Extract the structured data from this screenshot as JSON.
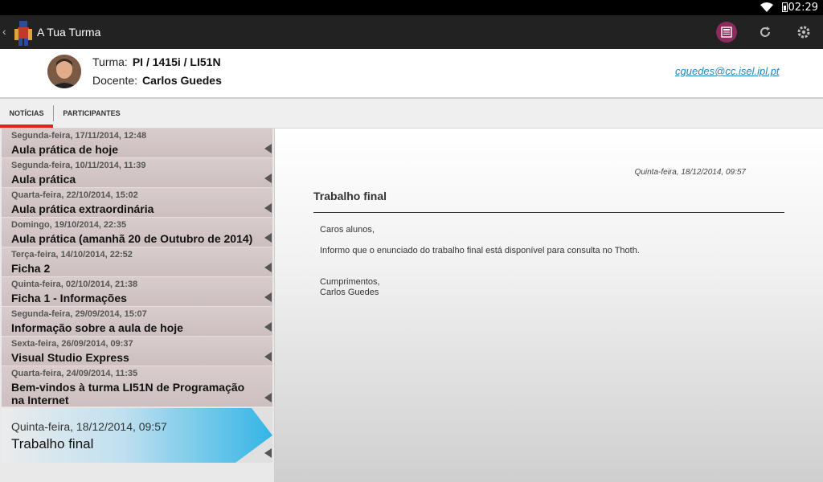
{
  "status_bar": {
    "time": "02:29",
    "wifi_icon": "wifi-icon",
    "battery_icon": "battery-icon"
  },
  "action_bar": {
    "back_icon": "chevron-left-icon",
    "app_title": "A Tua Turma",
    "actions": [
      {
        "name": "news-icon",
        "color": "#8e2b5e"
      },
      {
        "name": "refresh-icon"
      },
      {
        "name": "settings-icon"
      }
    ]
  },
  "header": {
    "turma_label": "Turma:",
    "turma_value": "PI / 1415i / LI51N",
    "docente_label": "Docente:",
    "docente_value": "Carlos Guedes",
    "email": "cguedes@cc.isel.ipl.pt"
  },
  "tabs": [
    {
      "label": "NOTÍCIAS",
      "active": true
    },
    {
      "label": "PARTICIPANTES",
      "active": false
    }
  ],
  "news": [
    {
      "date": "Segunda-feira, 17/11/2014, 12:48",
      "title": "Aula prática de hoje"
    },
    {
      "date": "Segunda-feira, 10/11/2014, 11:39",
      "title": "Aula prática"
    },
    {
      "date": "Quarta-feira, 22/10/2014, 15:02",
      "title": "Aula prática extraordinária"
    },
    {
      "date": "Domingo, 19/10/2014, 22:35",
      "title": "Aula prática (amanhã 20 de Outubro de 2014)"
    },
    {
      "date": "Terça-feira, 14/10/2014, 22:52",
      "title": "Ficha 2"
    },
    {
      "date": "Quinta-feira, 02/10/2014, 21:38",
      "title": "Ficha 1 - Informações"
    },
    {
      "date": "Segunda-feira, 29/09/2014, 15:07",
      "title": "Informação sobre a aula de hoje"
    },
    {
      "date": "Sexta-feira, 26/09/2014, 09:37",
      "title": "Visual Studio Express"
    },
    {
      "date": "Quarta-feira, 24/09/2014, 11:35",
      "title": "Bem-vindos à turma LI51N de Programação na Internet"
    }
  ],
  "selected_news": {
    "date": "Quinta-feira, 18/12/2014, 09:57",
    "title": "Trabalho final",
    "accent": "#33b5e5"
  },
  "detail": {
    "date": "Quinta-feira, 18/12/2014, 09:57",
    "title": "Trabalho final",
    "greeting": "Caros alunos,",
    "message": "Informo que o enunciado do trabalho final está disponível para consulta no Thoth.",
    "closing": "Cumprimentos,",
    "signature": "Carlos Guedes"
  }
}
